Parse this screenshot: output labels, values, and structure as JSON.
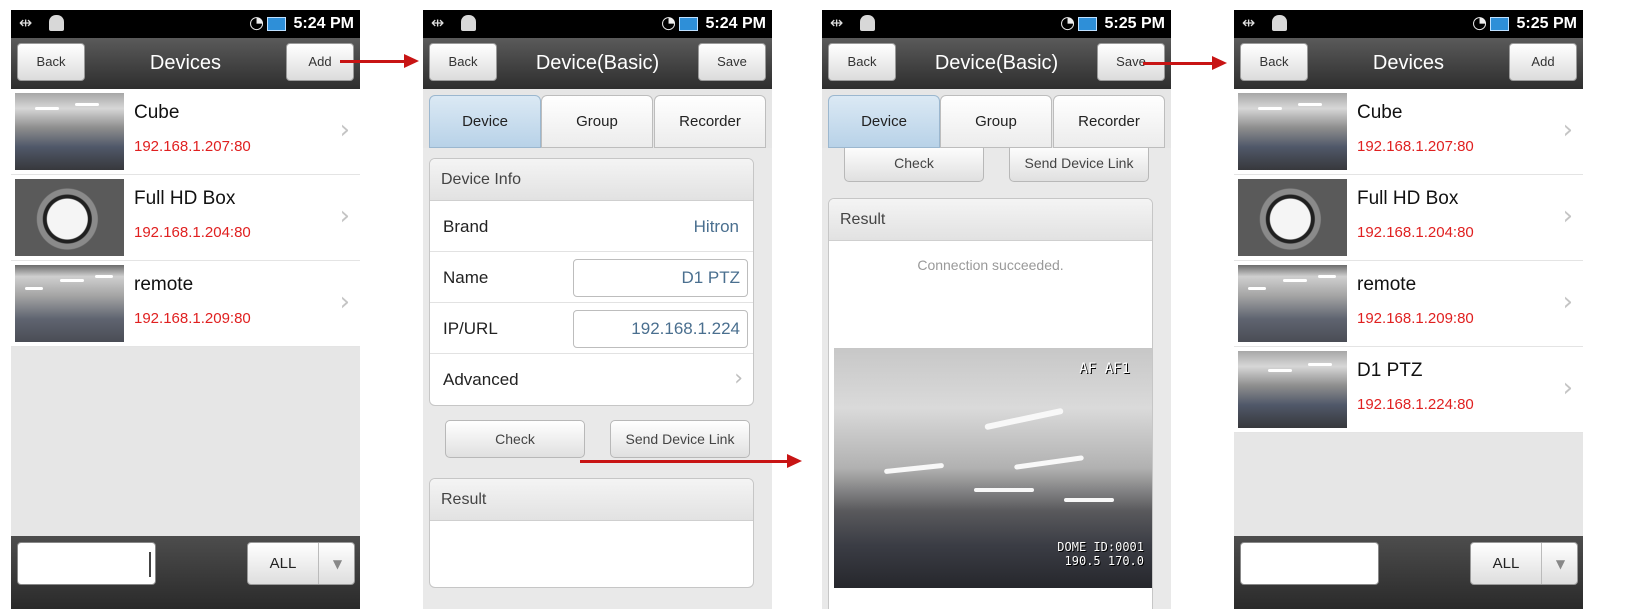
{
  "screens": [
    {
      "status_time": "5:24 PM",
      "title": "Devices",
      "back_label": "Back",
      "action_label": "Add",
      "devices": [
        {
          "name": "Cube",
          "ip": "192.168.1.207:80",
          "thumb": "office-camera-thumbnail"
        },
        {
          "name": "Full HD Box",
          "ip": "192.168.1.204:80",
          "thumb": "clock-camera-thumbnail"
        },
        {
          "name": "remote",
          "ip": "192.168.1.209:80",
          "thumb": "hallway-camera-thumbnail"
        }
      ],
      "filter_value": "ALL"
    },
    {
      "status_time": "5:24 PM",
      "title": "Device(Basic)",
      "back_label": "Back",
      "action_label": "Save",
      "tabs": [
        "Device",
        "Group",
        "Recorder"
      ],
      "active_tab": "Device",
      "device_info_header": "Device Info",
      "fields": [
        {
          "label": "Brand",
          "value": "Hitron"
        },
        {
          "label": "Name",
          "value": "D1 PTZ"
        },
        {
          "label": "IP/URL",
          "value": "192.168.1.224"
        },
        {
          "label": "Advanced",
          "value": ""
        }
      ],
      "check_label": "Check",
      "send_link_label": "Send Device Link",
      "result_header": "Result"
    },
    {
      "status_time": "5:25 PM",
      "title": "Device(Basic)",
      "back_label": "Back",
      "action_label": "Save",
      "tabs": [
        "Device",
        "Group",
        "Recorder"
      ],
      "active_tab": "Device",
      "check_label": "Check",
      "send_link_label": "Send Device Link",
      "result_header": "Result",
      "result_message": "Connection succeeded.",
      "osd_top": "AF AF1",
      "osd_bottom": "DOME ID:0001\n190.5 170.0"
    },
    {
      "status_time": "5:25 PM",
      "title": "Devices",
      "back_label": "Back",
      "action_label": "Add",
      "devices": [
        {
          "name": "Cube",
          "ip": "192.168.1.207:80",
          "thumb": "office-camera-thumbnail"
        },
        {
          "name": "Full HD Box",
          "ip": "192.168.1.204:80",
          "thumb": "clock-camera-thumbnail"
        },
        {
          "name": "remote",
          "ip": "192.168.1.209:80",
          "thumb": "hallway-camera-thumbnail"
        },
        {
          "name": "D1 PTZ",
          "ip": "192.168.1.224:80",
          "thumb": "ptz-camera-thumbnail"
        }
      ],
      "filter_value": "ALL"
    }
  ],
  "colors": {
    "ip_text": "#e02020",
    "flow_arrow": "#c81414",
    "active_tab": "#b8d2e8",
    "field_value": "#4a6f8f"
  },
  "icons": [
    "usb-icon",
    "android-icon",
    "wifi-icon",
    "battery-icon",
    "chevron-right-icon",
    "dropdown-arrow-icon"
  ]
}
